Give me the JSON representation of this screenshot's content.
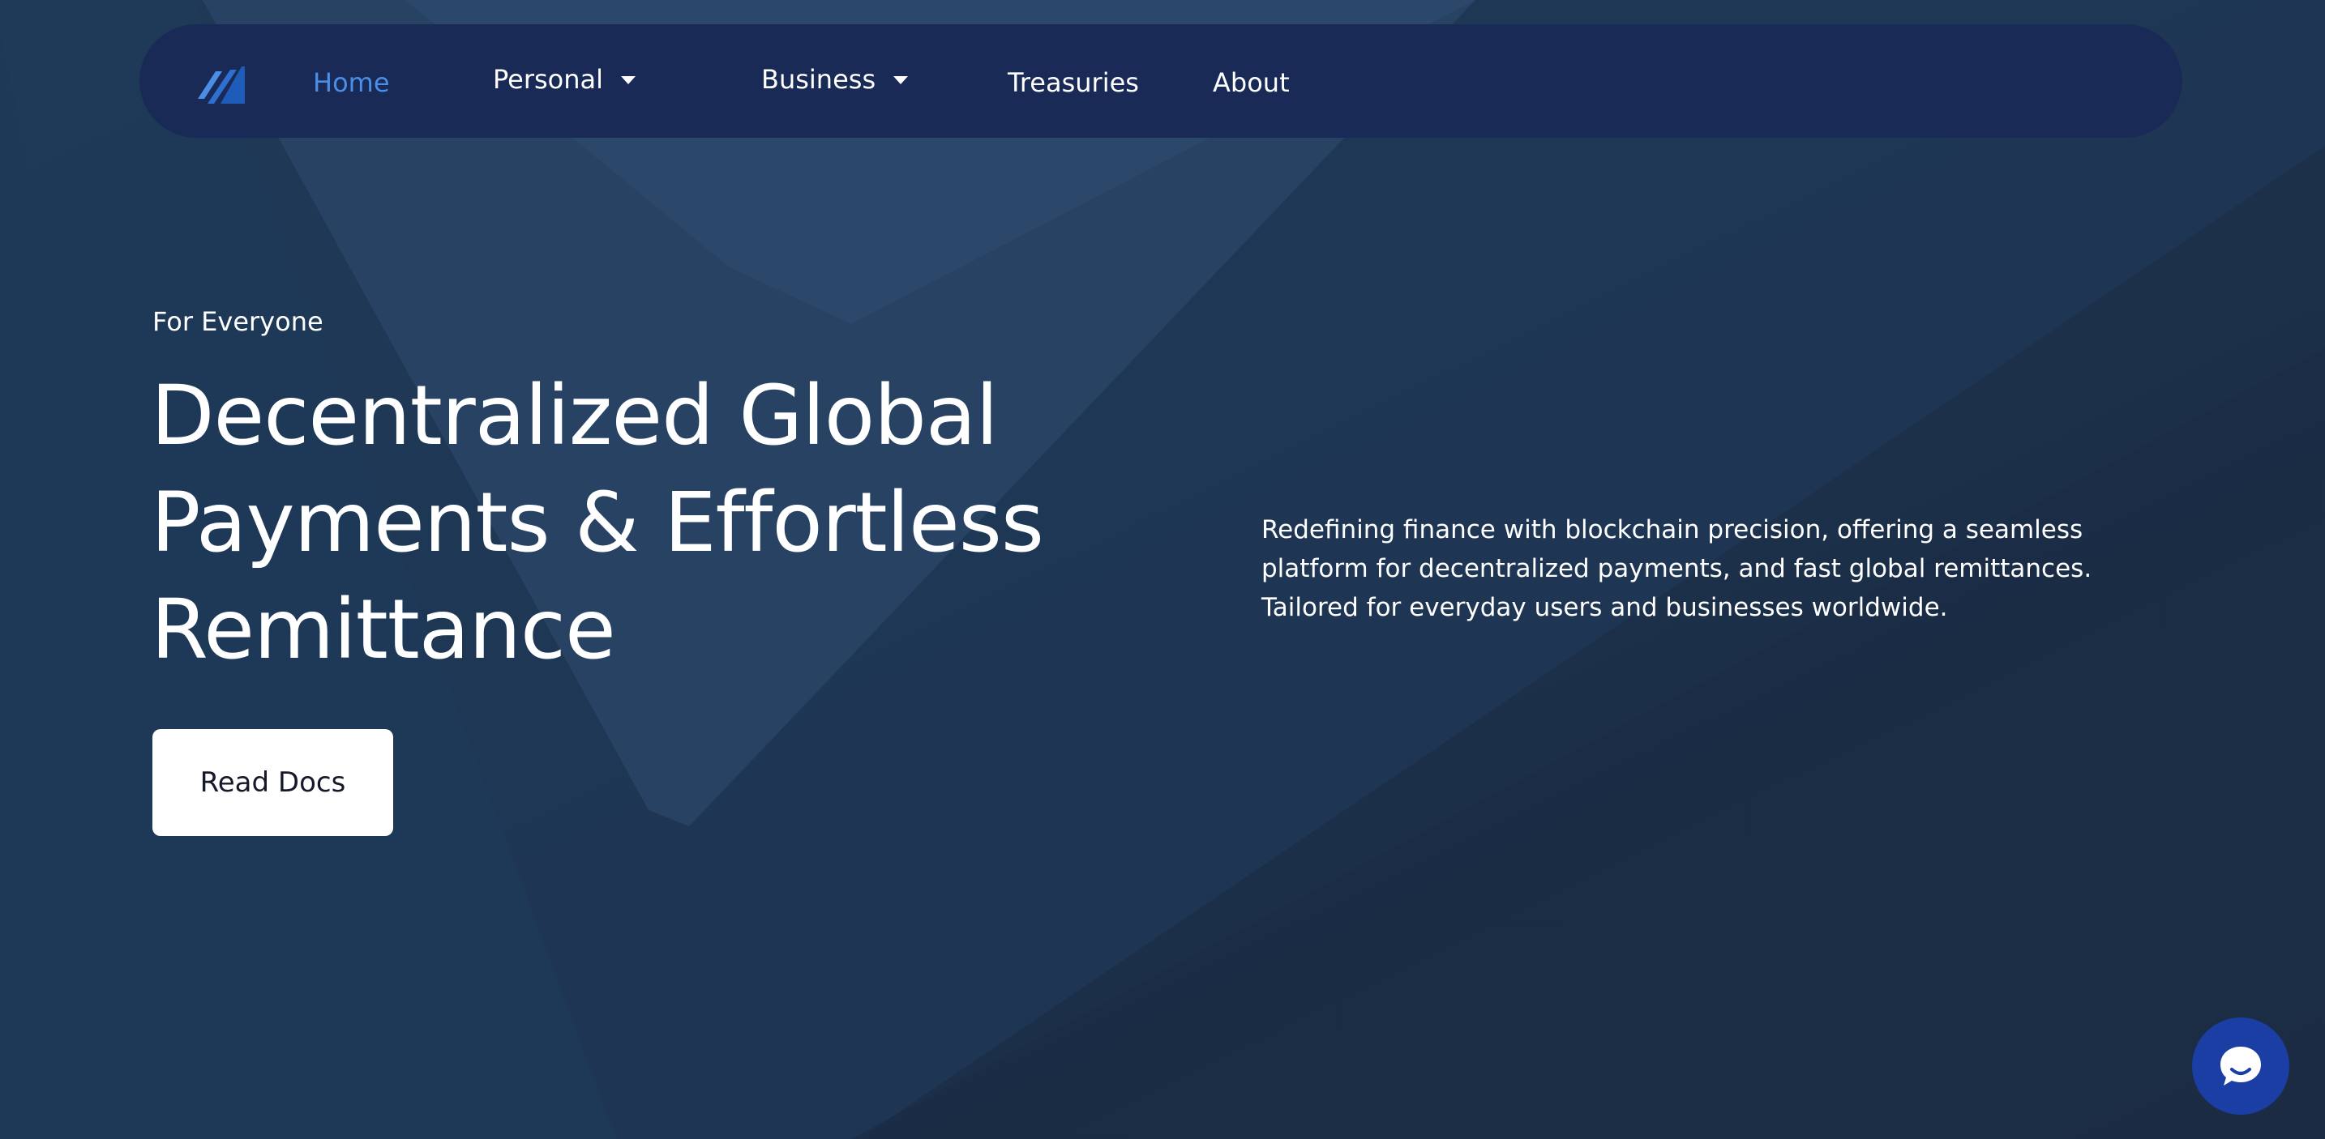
{
  "navbar": {
    "logo_icon": "brand-logo-icon",
    "items": [
      {
        "label": "Home",
        "active": true,
        "dropdown": false
      },
      {
        "label": "Personal",
        "active": false,
        "dropdown": true
      },
      {
        "label": "Business",
        "active": false,
        "dropdown": true
      },
      {
        "label": "Treasuries",
        "active": false,
        "dropdown": false
      },
      {
        "label": "About",
        "active": false,
        "dropdown": false
      }
    ]
  },
  "hero": {
    "eyebrow": "For Everyone",
    "title_lines": [
      "Decentralized Global",
      "Payments & Effortless",
      "Remittance"
    ],
    "cta_label": "Read Docs",
    "description_lines": [
      "Redefining finance with blockchain precision, offering a seamless",
      "platform for decentralized payments, and fast global remittances.",
      "Tailored for everyday users and businesses worldwide."
    ]
  },
  "chat_widget": {
    "icon": "chat-bubble-icon"
  },
  "colors": {
    "background": "#1c304b",
    "navbar": "#192a56",
    "active_link": "#4a8ee6",
    "chat_button": "#1b3ea5",
    "cta_background": "#ffffff"
  }
}
